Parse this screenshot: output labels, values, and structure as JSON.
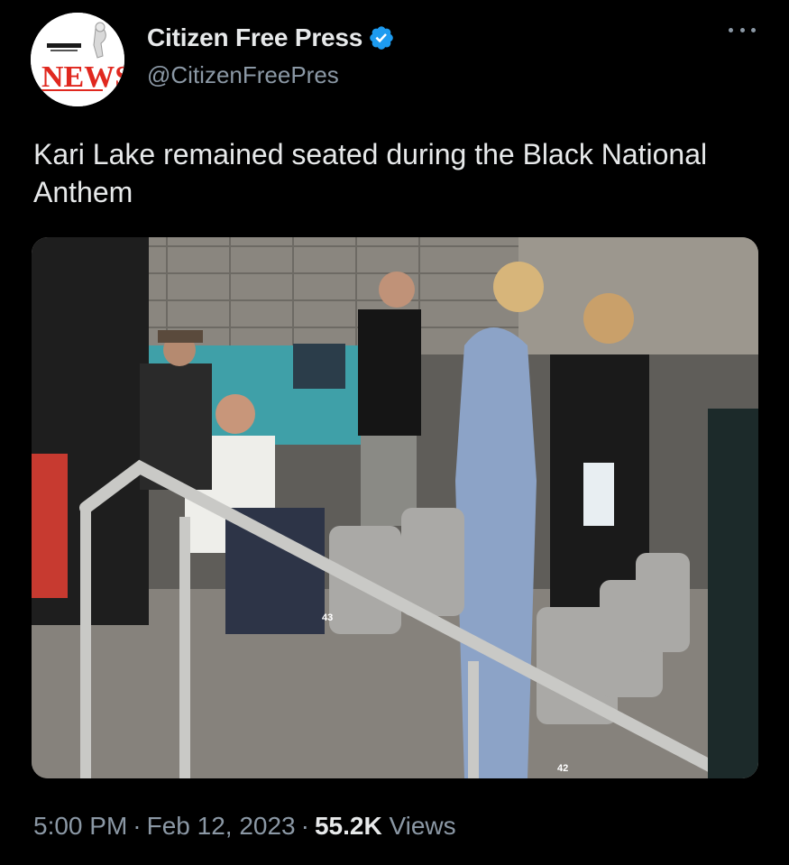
{
  "tweet": {
    "author": {
      "display_name": "Citizen Free Press",
      "handle": "@CitizenFreePres",
      "verified": true,
      "avatar": {
        "icon": "newspaper-logo-icon",
        "logo_text": "NEWS",
        "brand_color": "#e0281f"
      }
    },
    "more_icon": "more-options-icon",
    "text": "Kari Lake remained seated during the Black National Anthem",
    "media": {
      "type": "photo",
      "visible_labels": [
        "43",
        "42"
      ]
    },
    "meta": {
      "time": "5:00 PM",
      "date": "Feb 12, 2023",
      "views_count": "55.2K",
      "views_label": "Views"
    }
  },
  "colors": {
    "background": "#000000",
    "primary_text": "#e7e9ea",
    "secondary_text": "#8b98a5",
    "verified_badge": "#1d9bf0"
  }
}
